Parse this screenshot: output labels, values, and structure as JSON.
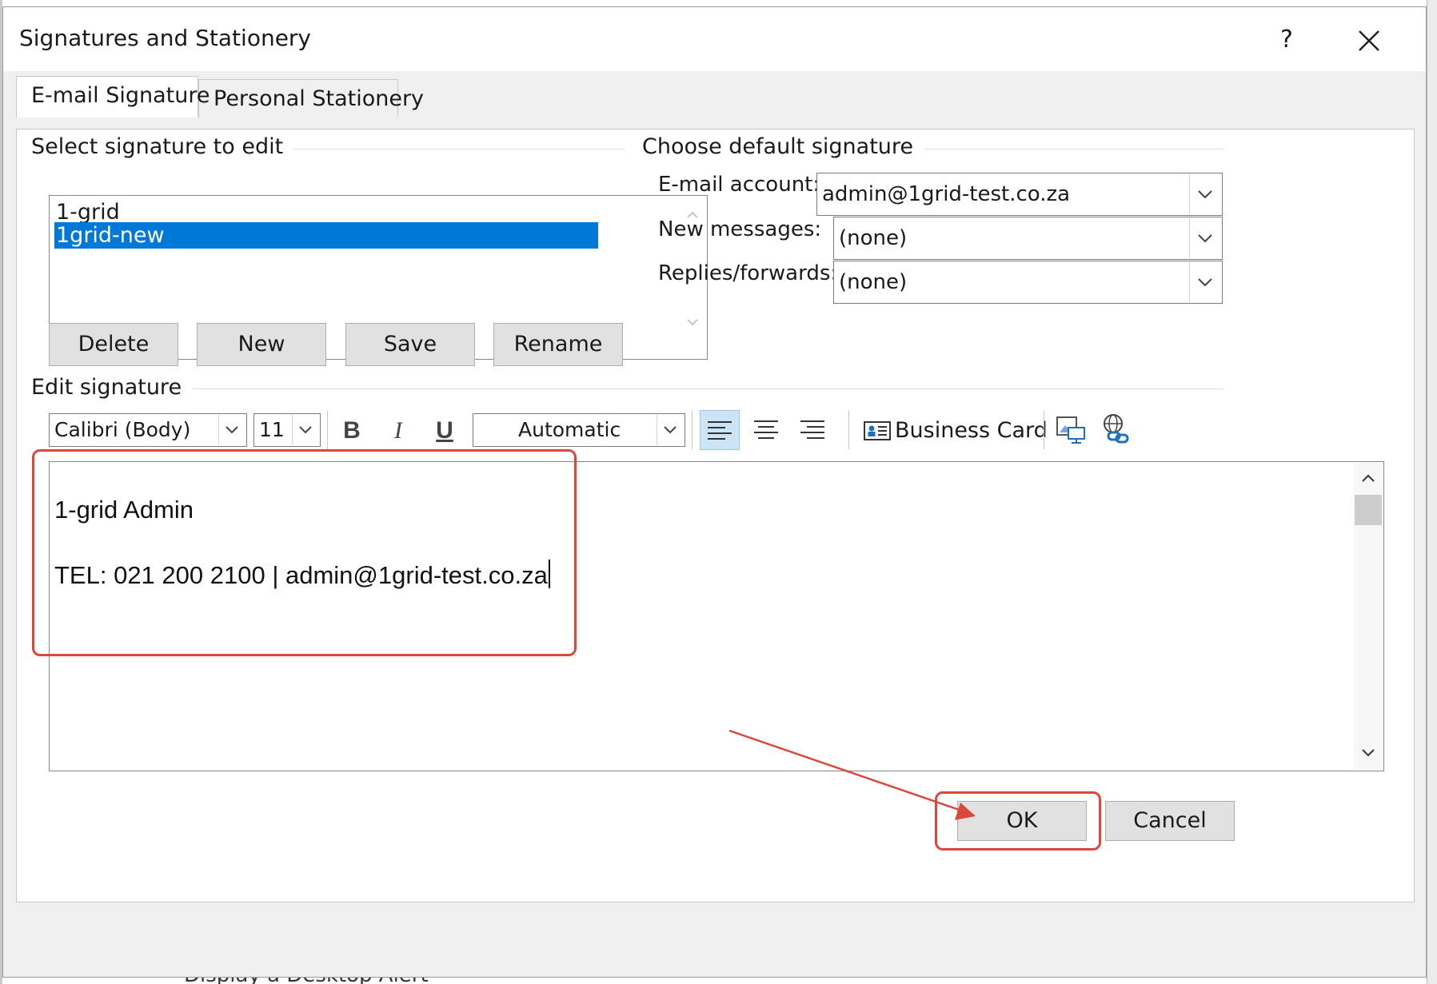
{
  "dialog": {
    "title": "Signatures and Stationery",
    "help_label": "?"
  },
  "tabs": [
    {
      "label": "E-mail Signature"
    },
    {
      "label": "Personal Stationery"
    }
  ],
  "select_signature": {
    "group_label": "Select signature to edit",
    "items": [
      "1-grid",
      "1grid-new"
    ],
    "selected_item": "1grid-new",
    "buttons": {
      "delete": "Delete",
      "new": "New",
      "save": "Save",
      "rename": "Rename"
    }
  },
  "default_signature": {
    "group_label": "Choose default signature",
    "email_account_label": "E-mail account:",
    "email_account_value": "admin@1grid-test.co.za",
    "new_messages_label": "New messages:",
    "new_messages_value": "(none)",
    "replies_label": "Replies/forwards:",
    "replies_value": "(none)"
  },
  "edit_signature": {
    "group_label": "Edit signature",
    "toolbar": {
      "font_name": "Calibri (Body)",
      "font_size": "11",
      "bold": "B",
      "italic": "I",
      "underline": "U",
      "color_value": "Automatic",
      "business_card_label": "Business Card"
    },
    "content": {
      "line1": "1-grid Admin",
      "line2": "TEL: 021 200 2100 | admin@1grid-test.co.za"
    }
  },
  "footer": {
    "ok_label": "OK",
    "cancel_label": "Cancel"
  },
  "background_text": "Display a Desktop Alert",
  "colors": {
    "selection": "#0078d7",
    "annotation": "#d9483b",
    "dialog_bg": "#f0f0f0"
  },
  "icons": [
    "close-icon",
    "chevron-up-icon",
    "chevron-down-icon",
    "align-left-icon",
    "align-center-icon",
    "align-right-icon",
    "business-card-icon",
    "insert-picture-icon",
    "hyperlink-icon"
  ]
}
